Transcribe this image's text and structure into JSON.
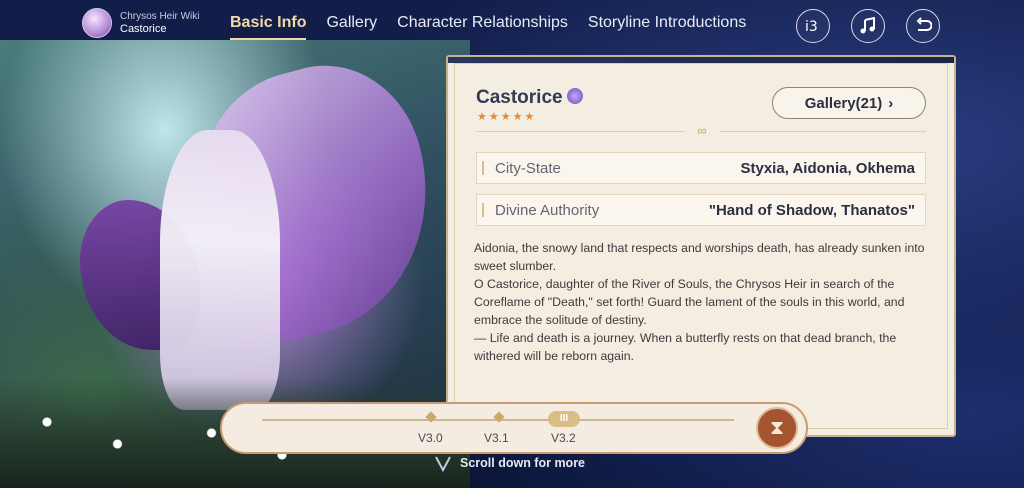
{
  "brand": {
    "wiki_title": "Chrysos Heir Wiki",
    "character": "Castorice"
  },
  "nav": {
    "tabs": [
      {
        "label": "Basic Info",
        "active": true
      },
      {
        "label": "Gallery"
      },
      {
        "label": "Character Relationships"
      },
      {
        "label": "Storyline Introductions"
      }
    ]
  },
  "header_icons": [
    "share-icon",
    "music-icon",
    "back-icon"
  ],
  "profile": {
    "name": "Castorice",
    "element_icon": "element-icon",
    "stars": "★★★★★",
    "gallery_button": "Gallery(21)",
    "divider_ornament": "∞",
    "attributes": [
      {
        "key": "City-State",
        "value": "Styxia, Aidonia, Okhema"
      },
      {
        "key": "Divine Authority",
        "value": "\"Hand of Shadow, Thanatos\""
      }
    ],
    "description": [
      "Aidonia, the snowy land that respects and worships death, has already sunken into sweet slumber.",
      "O Castorice, daughter of the River of Souls, the Chrysos Heir in search of the Coreflame of \"Death,\" set forth! Guard the lament of the souls in this world, and embrace the solitude of destiny.",
      "— Life and death is a journey. When a butterfly rests on that dead branch, the withered will be reborn again."
    ]
  },
  "timeline": {
    "versions": [
      "V3.0",
      "V3.1",
      "V3.2"
    ],
    "current": "V3.2",
    "current_marker": "III"
  },
  "scroll_hint": "Scroll down for more",
  "colors": {
    "accent_gold": "#f1d9a8",
    "panel_bg": "#f3ede2",
    "timeline_button": "#a55432",
    "star": "#e08a3a"
  }
}
